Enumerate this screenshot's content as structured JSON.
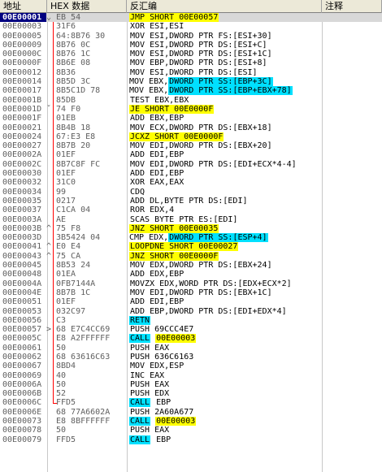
{
  "columns": {
    "address": "地址",
    "hex": "HEX 数据",
    "disasm": "反汇编",
    "comment": "注释"
  },
  "colors": {
    "jump_highlight": "#ffff00",
    "mem_highlight": "#00e0ff",
    "call_highlight": "#00e0ff",
    "selection": "#000080",
    "jump_arrow": "#ff0000"
  },
  "rows": [
    {
      "addr": "00E00001",
      "jump": "⌄",
      "hex": "EB 54",
      "asm": "JMP SHORT 00E00057",
      "hl": "yellow",
      "sel": true
    },
    {
      "addr": "00E00003",
      "jump": "",
      "hex": "31F6",
      "asm": "XOR ESI,ESI"
    },
    {
      "addr": "00E00005",
      "jump": "",
      "hex": "64:8B76 30",
      "asm": "MOV ESI,DWORD PTR FS:[ESI+30]"
    },
    {
      "addr": "00E00009",
      "jump": "",
      "hex": "8B76 0C",
      "asm": "MOV ESI,DWORD PTR DS:[ESI+C]"
    },
    {
      "addr": "00E0000C",
      "jump": "",
      "hex": "8B76 1C",
      "asm": "MOV ESI,DWORD PTR DS:[ESI+1C]"
    },
    {
      "addr": "00E0000F",
      "jump": "",
      "hex": "8B6E 08",
      "asm": "MOV EBP,DWORD PTR DS:[ESI+8]"
    },
    {
      "addr": "00E00012",
      "jump": "",
      "hex": "8B36",
      "asm": "MOV ESI,DWORD PTR DS:[ESI]"
    },
    {
      "addr": "00E00014",
      "jump": "",
      "hex": "8B5D 3C",
      "asm_pre": "MOV EBX,",
      "asm_hl": "DWORD PTR SS:[EBP+3C]",
      "hl": "cyan_part"
    },
    {
      "addr": "00E00017",
      "jump": "",
      "hex": "8B5C1D 78",
      "asm_pre": "MOV EBX,",
      "asm_hl": "DWORD PTR SS:[EBP+EBX+78]",
      "hl": "cyan_part"
    },
    {
      "addr": "00E0001B",
      "jump": "",
      "hex": "85DB",
      "asm": "TEST EBX,EBX"
    },
    {
      "addr": "00E0001D",
      "jump": "ˇ",
      "hex": "74 F0",
      "asm": "JE SHORT 00E0000F",
      "hl": "yellow"
    },
    {
      "addr": "00E0001F",
      "jump": "",
      "hex": "01EB",
      "asm": "ADD EBX,EBP"
    },
    {
      "addr": "00E00021",
      "jump": "",
      "hex": "8B4B 18",
      "asm": "MOV ECX,DWORD PTR DS:[EBX+18]"
    },
    {
      "addr": "00E00024",
      "jump": "",
      "hex": "67:E3 E8",
      "asm": "JCXZ SHORT 00E0000F",
      "hl": "yellow"
    },
    {
      "addr": "00E00027",
      "jump": "",
      "hex": "8B7B 20",
      "asm": "MOV EDI,DWORD PTR DS:[EBX+20]"
    },
    {
      "addr": "00E0002A",
      "jump": "",
      "hex": "01EF",
      "asm": "ADD EDI,EBP"
    },
    {
      "addr": "00E0002C",
      "jump": "",
      "hex": "8B7C8F FC",
      "asm": "MOV EDI,DWORD PTR DS:[EDI+ECX*4-4]"
    },
    {
      "addr": "00E00030",
      "jump": "",
      "hex": "01EF",
      "asm": "ADD EDI,EBP"
    },
    {
      "addr": "00E00032",
      "jump": "",
      "hex": "31C0",
      "asm": "XOR EAX,EAX"
    },
    {
      "addr": "00E00034",
      "jump": "",
      "hex": "99",
      "asm": "CDQ"
    },
    {
      "addr": "00E00035",
      "jump": "",
      "hex": "0217",
      "asm": "ADD DL,BYTE PTR DS:[EDI]"
    },
    {
      "addr": "00E00037",
      "jump": "",
      "hex": "C1CA 04",
      "asm": "ROR EDX,4"
    },
    {
      "addr": "00E0003A",
      "jump": "",
      "hex": "AE",
      "asm": "SCAS BYTE PTR ES:[EDI]"
    },
    {
      "addr": "00E0003B",
      "jump": "^",
      "hex": "75 F8",
      "asm": "JNZ SHORT 00E00035",
      "hl": "yellow"
    },
    {
      "addr": "00E0003D",
      "jump": "",
      "hex": "3B5424 04",
      "asm_pre": "CMP EDX,",
      "asm_hl": "DWORD PTR SS:[ESP+4]",
      "hl": "cyan_part"
    },
    {
      "addr": "00E00041",
      "jump": "^",
      "hex": "E0 E4",
      "asm": "LOOPDNE SHORT 00E00027",
      "hl": "yellow"
    },
    {
      "addr": "00E00043",
      "jump": "^",
      "hex": "75 CA",
      "asm": "JNZ SHORT 00E0000F",
      "hl": "yellow"
    },
    {
      "addr": "00E00045",
      "jump": "",
      "hex": "8B53 24",
      "asm": "MOV EDX,DWORD PTR DS:[EBX+24]"
    },
    {
      "addr": "00E00048",
      "jump": "",
      "hex": "01EA",
      "asm": "ADD EDX,EBP"
    },
    {
      "addr": "00E0004A",
      "jump": "",
      "hex": "0FB7144A",
      "asm": "MOVZX EDX,WORD PTR DS:[EDX+ECX*2]"
    },
    {
      "addr": "00E0004E",
      "jump": "",
      "hex": "8B7B 1C",
      "asm": "MOV EDI,DWORD PTR DS:[EBX+1C]"
    },
    {
      "addr": "00E00051",
      "jump": "",
      "hex": "01EF",
      "asm": "ADD EDI,EBP"
    },
    {
      "addr": "00E00053",
      "jump": "",
      "hex": "032C97",
      "asm": "ADD EBP,DWORD PTR DS:[EDI+EDX*4]"
    },
    {
      "addr": "00E00056",
      "jump": "",
      "hex": "C3",
      "asm": "RETN",
      "hl": "cyan"
    },
    {
      "addr": "00E00057",
      "jump": ">",
      "hex": "68 E7C4CC69",
      "asm": "PUSH 69CCC4E7"
    },
    {
      "addr": "00E0005C",
      "jump": "",
      "hex": "E8 A2FFFFFF",
      "asm_call": "CALL",
      "asm_post": "00E00003",
      "hl": "call_yellow"
    },
    {
      "addr": "00E00061",
      "jump": "",
      "hex": "50",
      "asm": "PUSH EAX"
    },
    {
      "addr": "00E00062",
      "jump": "",
      "hex": "68 63616C63",
      "asm": "PUSH 636C6163"
    },
    {
      "addr": "00E00067",
      "jump": "",
      "hex": "8BD4",
      "asm": "MOV EDX,ESP"
    },
    {
      "addr": "00E00069",
      "jump": "",
      "hex": "40",
      "asm": "INC EAX"
    },
    {
      "addr": "00E0006A",
      "jump": "",
      "hex": "50",
      "asm": "PUSH EAX"
    },
    {
      "addr": "00E0006B",
      "jump": "",
      "hex": "52",
      "asm": "PUSH EDX"
    },
    {
      "addr": "00E0006C",
      "jump": "",
      "hex": "FFD5",
      "asm_call": "CALL",
      "asm_post": "EBP",
      "hl": "call_plain"
    },
    {
      "addr": "00E0006E",
      "jump": "",
      "hex": "68 77A6602A",
      "asm": "PUSH 2A60A677"
    },
    {
      "addr": "00E00073",
      "jump": "",
      "hex": "E8 8BFFFFFF",
      "asm_call": "CALL",
      "asm_post": "00E00003",
      "hl": "call_yellow"
    },
    {
      "addr": "00E00078",
      "jump": "",
      "hex": "50",
      "asm": "PUSH EAX"
    },
    {
      "addr": "00E00079",
      "jump": "",
      "hex": "FFD5",
      "asm_call": "CALL",
      "asm_post": "EBP",
      "hl": "call_plain"
    }
  ]
}
